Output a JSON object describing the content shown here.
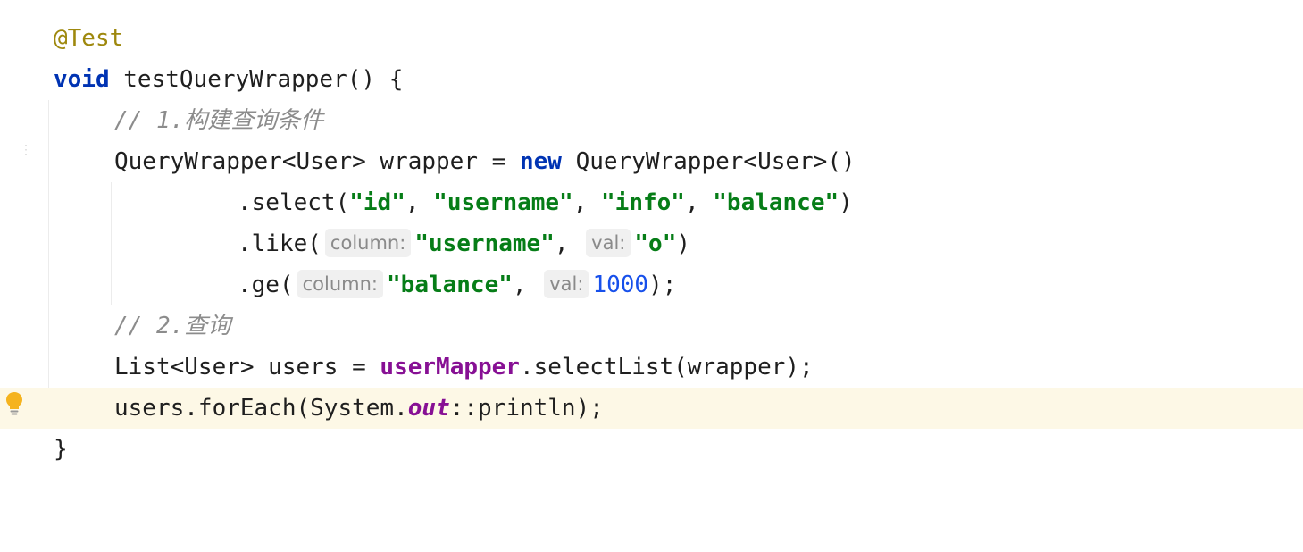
{
  "editor": {
    "lines": [
      {
        "segments": [
          {
            "t": "@Test",
            "k": "anno"
          }
        ]
      },
      {
        "segments": [
          {
            "t": "void",
            "k": "kw"
          },
          {
            "t": " testQueryWrapper() {",
            "k": "plain"
          }
        ]
      },
      {
        "segments": [
          {
            "t": "// 1.构建查询条件",
            "k": "cmt"
          }
        ]
      },
      {
        "segments": [
          {
            "t": "QueryWrapper<User> wrapper = ",
            "k": "plain"
          },
          {
            "t": "new",
            "k": "kw"
          },
          {
            "t": " QueryWrapper<User>()",
            "k": "plain"
          }
        ]
      },
      {
        "segments": [
          {
            "t": ".select(",
            "k": "plain"
          },
          {
            "t": "\"id\"",
            "k": "str"
          },
          {
            "t": ", ",
            "k": "plain"
          },
          {
            "t": "\"username\"",
            "k": "str"
          },
          {
            "t": ", ",
            "k": "plain"
          },
          {
            "t": "\"info\"",
            "k": "str"
          },
          {
            "t": ", ",
            "k": "plain"
          },
          {
            "t": "\"balance\"",
            "k": "str"
          },
          {
            "t": ")",
            "k": "plain"
          }
        ]
      },
      {
        "segments": [
          {
            "t": ".like(",
            "k": "plain"
          },
          {
            "t": "column:",
            "k": "hint"
          },
          {
            "t": "\"username\"",
            "k": "str"
          },
          {
            "t": ", ",
            "k": "plain"
          },
          {
            "t": "val:",
            "k": "hint"
          },
          {
            "t": "\"o\"",
            "k": "str"
          },
          {
            "t": ")",
            "k": "plain"
          }
        ]
      },
      {
        "segments": [
          {
            "t": ".ge(",
            "k": "plain"
          },
          {
            "t": "column:",
            "k": "hint"
          },
          {
            "t": "\"balance\"",
            "k": "str"
          },
          {
            "t": ", ",
            "k": "plain"
          },
          {
            "t": "val:",
            "k": "hint"
          },
          {
            "t": "1000",
            "k": "num"
          },
          {
            "t": ");",
            "k": "plain"
          }
        ]
      },
      {
        "segments": [
          {
            "t": "// 2.查询",
            "k": "cmt"
          }
        ]
      },
      {
        "segments": [
          {
            "t": "List<User> users = ",
            "k": "plain"
          },
          {
            "t": "userMapper",
            "k": "field"
          },
          {
            "t": ".selectList(wrapper);",
            "k": "plain"
          }
        ]
      },
      {
        "segments": [
          {
            "t": "users.forEach(System.",
            "k": "plain"
          },
          {
            "t": "out",
            "k": "static-field"
          },
          {
            "t": "::println);",
            "k": "plain"
          }
        ]
      },
      {
        "segments": [
          {
            "t": "}",
            "k": "plain"
          }
        ]
      }
    ]
  },
  "gutter": {
    "bulb_icon": "lightbulb-icon",
    "current_line_index": 9
  },
  "colors": {
    "keyword": "#0033b3",
    "string": "#067d17",
    "number": "#1750eb",
    "comment": "#8c8c8c",
    "annotation": "#9e880d",
    "field": "#871094",
    "current_line_bg": "#fdf8e6",
    "bulb": "#f5b31e"
  }
}
